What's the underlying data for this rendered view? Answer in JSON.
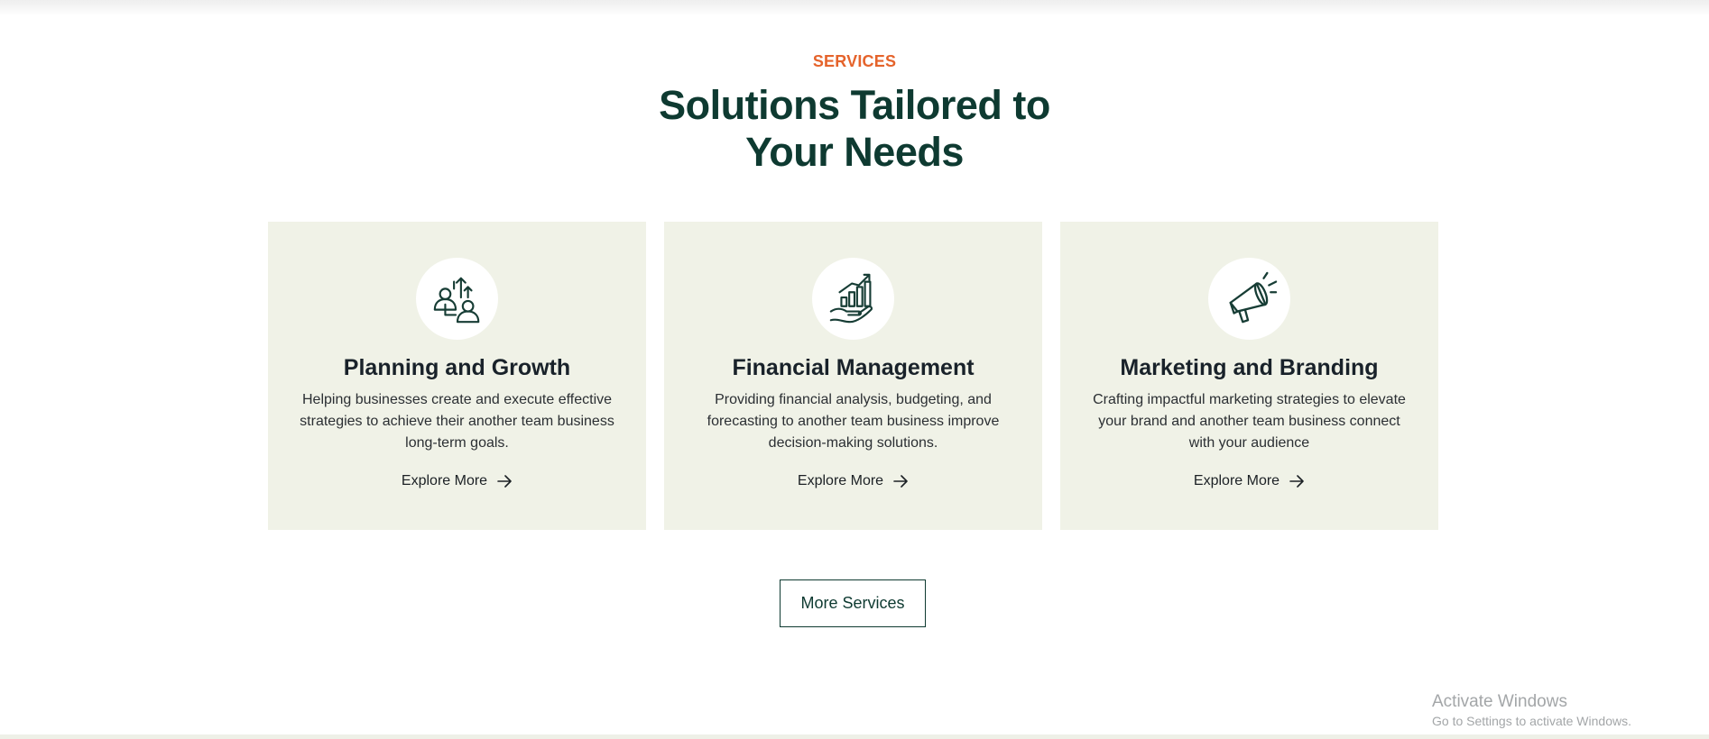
{
  "section": {
    "eyebrow": "SERVICES",
    "title": "Solutions Tailored to Your Needs"
  },
  "colors": {
    "accent": "#e5632b",
    "primary_dark": "#0e3a31",
    "card_bg": "#f0f2e7"
  },
  "cards": [
    {
      "icon": "planning-growth-icon",
      "title": "Planning and Growth",
      "description": "Helping businesses create and execute effective strategies to achieve their another team business long-term goals.",
      "link_label": "Explore More"
    },
    {
      "icon": "financial-chart-hand-icon",
      "title": "Financial Management",
      "description": "Providing financial analysis, budgeting, and forecasting to another team business improve decision-making solutions.",
      "link_label": "Explore More"
    },
    {
      "icon": "megaphone-icon",
      "title": "Marketing and Branding",
      "description": "Crafting impactful marketing strategies to elevate your brand and another team business connect with your audience",
      "link_label": "Explore More"
    }
  ],
  "more_button": "More Services",
  "watermark": {
    "line1": "Activate Windows",
    "line2": "Go to Settings to activate Windows."
  }
}
